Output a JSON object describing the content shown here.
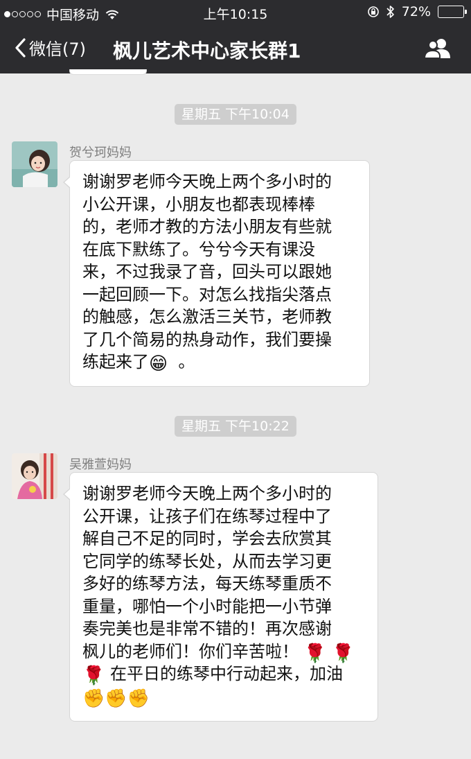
{
  "status_bar": {
    "carrier": "中国移动",
    "time": "上午10:15",
    "battery": "72%",
    "battery_level": 0.72
  },
  "nav": {
    "back_label": "微信(7)",
    "title": "枫儿艺术中心家长群1",
    "group_icon": "group-members-icon"
  },
  "messages": [
    {
      "timestamp": "星期五 下午10:04",
      "sender": "贺兮珂妈妈",
      "lines": [
        "谢谢罗老师今天晚上两个多小时的",
        "小公开课，小朋友也都表现棒棒",
        "的，老师才教的方法小朋友有些就",
        "在底下默练了。兮兮今天有课没",
        "来，不过我录了音，回头可以跟她",
        "一起回顾一下。对怎么找指尖落点",
        "的触感，怎么激活三关节，老师教",
        "了几个简易的热身动作，我们要操"
      ],
      "last_line_text": "练起来了",
      "last_line_emoji": "😁",
      "last_line_end": "。"
    },
    {
      "timestamp": "星期五 下午10:22",
      "sender": "吴雅萱妈妈",
      "lines": [
        "谢谢罗老师今天晚上两个多小时的",
        "公开课，让孩子们在练琴过程中了",
        "解自己不足的同时，学会去欣赏其",
        "它同学的练琴长处，从而去学习更",
        "多好的练琴方法，每天练琴重质不",
        "重量，哪怕一个小时能把一小节弹",
        "奏完美也是非常不错的！再次感谢"
      ],
      "line8_text": "枫儿的老师们！你们辛苦啦！",
      "line8_emoji": "🌹 🌹",
      "line9_emoji": "🌹",
      "line9_text": "在平日的练琴中行动起来，加油",
      "line10_emoji": "✊✊✊"
    }
  ]
}
